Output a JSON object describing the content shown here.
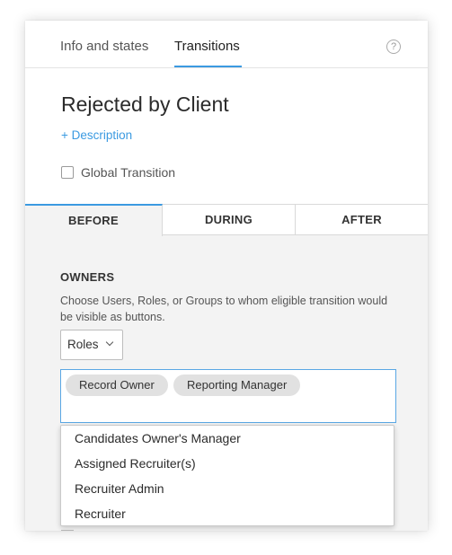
{
  "tabs": {
    "info": "Info and states",
    "transitions": "Transitions",
    "help": "?"
  },
  "transition": {
    "title": "Rejected by Client",
    "description_link": "+ Description",
    "global_label": "Global Transition"
  },
  "phase_tabs": {
    "before": "BEFORE",
    "during": "DURING",
    "after": "AFTER"
  },
  "owners": {
    "heading": "OWNERS",
    "help_text": "Choose Users, Roles, or Groups to whom eligible transition would be visible as buttons.",
    "select_value": "Roles",
    "tags": [
      "Record Owner",
      "Reporting Manager"
    ],
    "dropdown_items": [
      "Candidates Owner's Manager",
      "Assigned Recruiter(s)",
      "Recruiter Admin",
      "Recruiter"
    ]
  },
  "colors": {
    "accent": "#3b9ae1",
    "tag_bg": "#e1e1e1",
    "panel_bg": "#f3f3f3"
  },
  "icons": {
    "help": "help-circle-icon",
    "select_arrow": "chevron-down-icon"
  }
}
